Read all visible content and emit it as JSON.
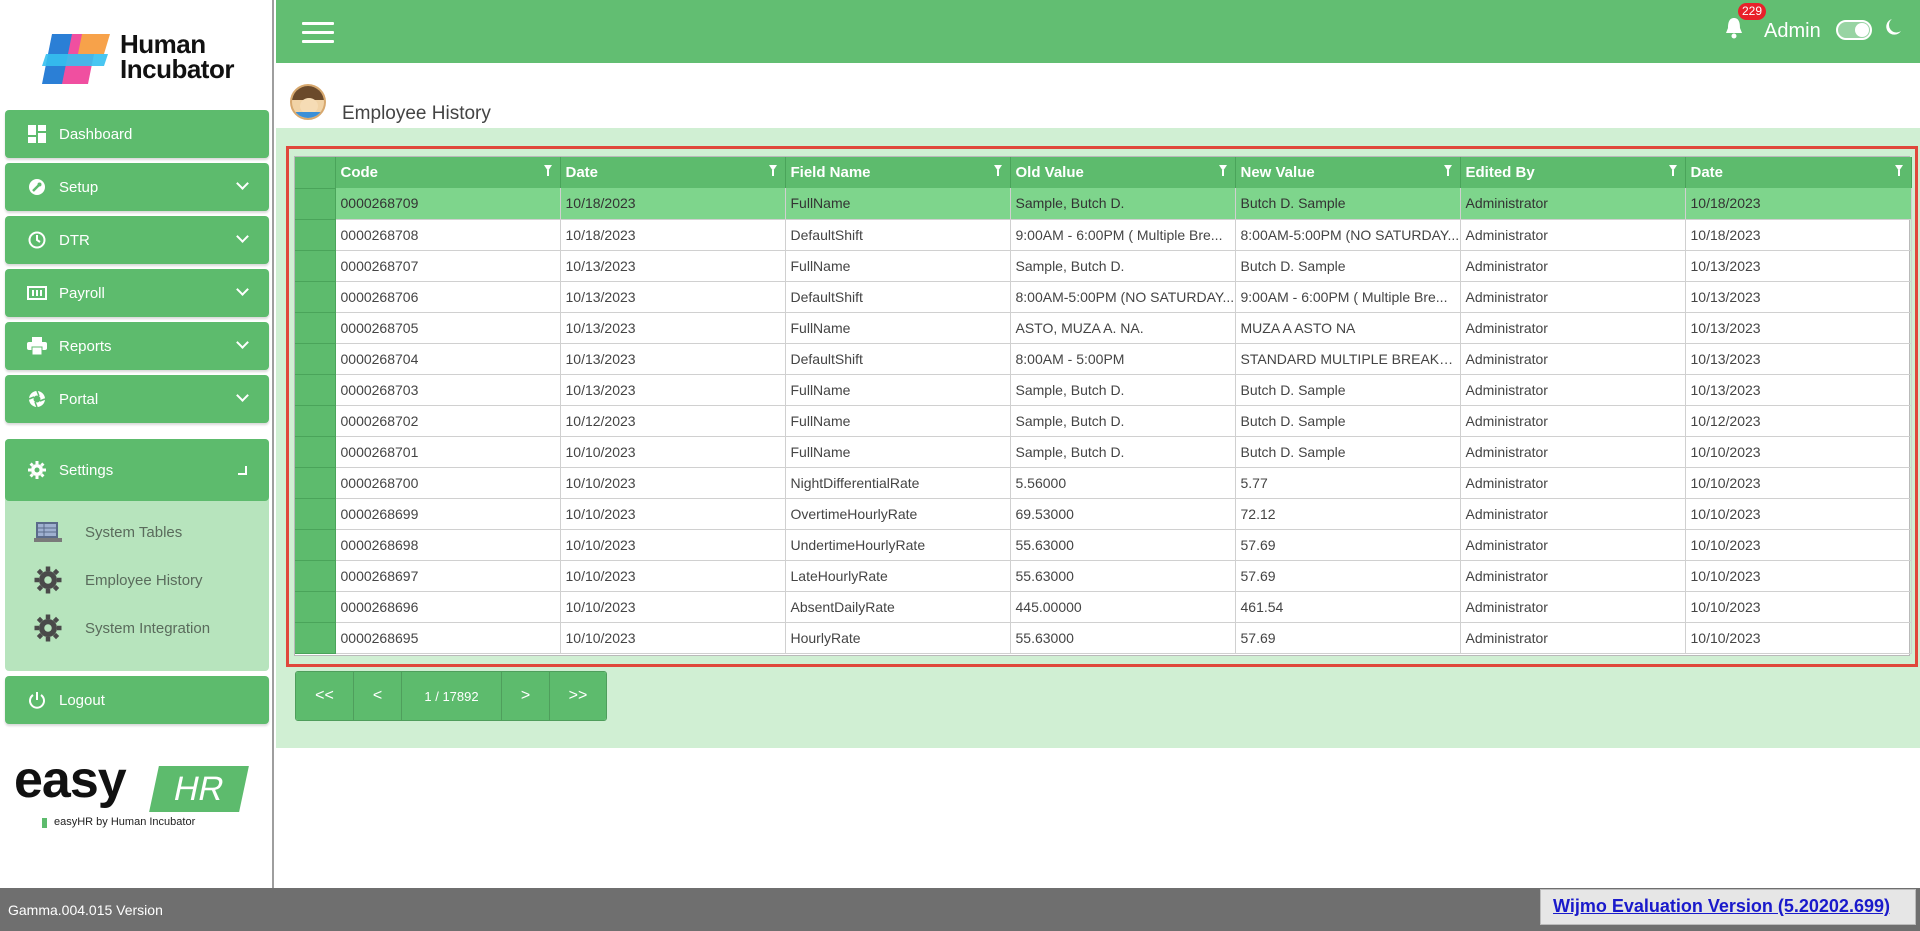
{
  "brand": {
    "line1": "Human",
    "line2": "Incubator"
  },
  "sidebar": {
    "items": [
      {
        "label": "Dashboard",
        "icon": "dashboard-icon"
      },
      {
        "label": "Setup",
        "icon": "wrench-icon"
      },
      {
        "label": "DTR",
        "icon": "clock-icon"
      },
      {
        "label": "Payroll",
        "icon": "payroll-icon"
      },
      {
        "label": "Reports",
        "icon": "printer-icon"
      },
      {
        "label": "Portal",
        "icon": "aperture-icon"
      }
    ],
    "settings": {
      "label": "Settings",
      "subitems": [
        {
          "label": "System Tables",
          "icon": "table-icon"
        },
        {
          "label": "Employee History",
          "icon": "gear-icon"
        },
        {
          "label": "System Integration",
          "icon": "gear-icon"
        }
      ]
    },
    "logout": "Logout",
    "easy_logo": {
      "easy": "easy",
      "hr": "HR",
      "tagline": "easyHR by Human Incubator"
    }
  },
  "header": {
    "notification_count": "229",
    "user": "Admin"
  },
  "page": {
    "title": "Employee History"
  },
  "grid": {
    "columns": [
      "Code",
      "Date",
      "Field Name",
      "Old Value",
      "New Value",
      "Edited By",
      "Date"
    ],
    "rows": [
      [
        "0000268709",
        "10/18/2023",
        "FullName",
        "Sample, Butch D.",
        "Butch D. Sample",
        "Administrator",
        "10/18/2023"
      ],
      [
        "0000268708",
        "10/18/2023",
        "DefaultShift",
        "9:00AM - 6:00PM ( Multiple Bre...",
        "8:00AM-5:00PM (NO SATURDAY...",
        "Administrator",
        "10/18/2023"
      ],
      [
        "0000268707",
        "10/13/2023",
        "FullName",
        "Sample, Butch D.",
        "Butch D. Sample",
        "Administrator",
        "10/13/2023"
      ],
      [
        "0000268706",
        "10/13/2023",
        "DefaultShift",
        "8:00AM-5:00PM (NO SATURDAY...",
        "9:00AM - 6:00PM ( Multiple Bre...",
        "Administrator",
        "10/13/2023"
      ],
      [
        "0000268705",
        "10/13/2023",
        "FullName",
        "ASTO, MUZA A. NA.",
        "MUZA A ASTO NA",
        "Administrator",
        "10/13/2023"
      ],
      [
        "0000268704",
        "10/13/2023",
        "DefaultShift",
        "8:00AM - 5:00PM",
        "STANDARD MULTIPLE BREAKS (...",
        "Administrator",
        "10/13/2023"
      ],
      [
        "0000268703",
        "10/13/2023",
        "FullName",
        "Sample, Butch D.",
        "Butch D. Sample",
        "Administrator",
        "10/13/2023"
      ],
      [
        "0000268702",
        "10/12/2023",
        "FullName",
        "Sample, Butch D.",
        "Butch D. Sample",
        "Administrator",
        "10/12/2023"
      ],
      [
        "0000268701",
        "10/10/2023",
        "FullName",
        "Sample, Butch D.",
        "Butch D. Sample",
        "Administrator",
        "10/10/2023"
      ],
      [
        "0000268700",
        "10/10/2023",
        "NightDifferentialRate",
        "5.56000",
        "5.77",
        "Administrator",
        "10/10/2023"
      ],
      [
        "0000268699",
        "10/10/2023",
        "OvertimeHourlyRate",
        "69.53000",
        "72.12",
        "Administrator",
        "10/10/2023"
      ],
      [
        "0000268698",
        "10/10/2023",
        "UndertimeHourlyRate",
        "55.63000",
        "57.69",
        "Administrator",
        "10/10/2023"
      ],
      [
        "0000268697",
        "10/10/2023",
        "LateHourlyRate",
        "55.63000",
        "57.69",
        "Administrator",
        "10/10/2023"
      ],
      [
        "0000268696",
        "10/10/2023",
        "AbsentDailyRate",
        "445.00000",
        "461.54",
        "Administrator",
        "10/10/2023"
      ],
      [
        "0000268695",
        "10/10/2023",
        "HourlyRate",
        "55.63000",
        "57.69",
        "Administrator",
        "10/10/2023"
      ]
    ],
    "selected_row": 0
  },
  "pager": {
    "first": "<<",
    "prev": "<",
    "info": "1 / 17892",
    "next": ">",
    "last": ">>"
  },
  "footer": {
    "version": "Gamma.004.015 Version",
    "wijmo": "Wijmo Evaluation Version (5.20202.699)"
  },
  "colors": {
    "accent": "#5dbb6d",
    "band": "#d0efd3",
    "badge": "#e8212a",
    "highlight": "#e0473b"
  }
}
